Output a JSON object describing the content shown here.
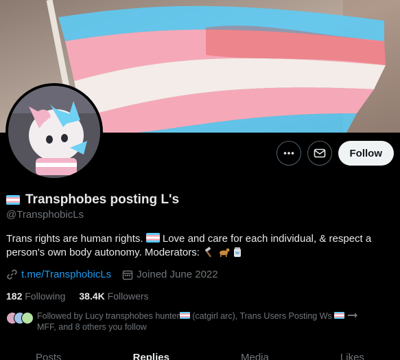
{
  "banner": {
    "flag_colors": [
      "#5bcefa",
      "#f5a9b8",
      "#ffffff",
      "#f5a9b8",
      "#5bcefa"
    ]
  },
  "avatar": {
    "name": "profile-avatar"
  },
  "actions": {
    "more_icon": "more-icon",
    "message_icon": "mail-icon",
    "follow_label": "Follow"
  },
  "profile": {
    "display_name": "Transphobes posting L's",
    "handle": "@TransphobicLs",
    "bio_text": "Trans rights are human rights.",
    "bio_text_2": "Love and care for each individual, & respect a person's own body autonomy. Moderators:",
    "website": "t.me/TransphobicLs",
    "joined": "Joined June 2022"
  },
  "stats": {
    "following_count": "182",
    "following_label": "Following",
    "followers_count": "38.4K",
    "followers_label": "Followers"
  },
  "followed_by": {
    "prefix": "Followed by Lucy transphobes hunter",
    "mid": "(catgirl arc), Trans Users Posting Ws",
    "suffix": "MFF, and 8 others you follow"
  },
  "tabs": [
    "Posts",
    "Replies",
    "Media",
    "Likes"
  ],
  "active_tab_index": 1,
  "colors": {
    "accent": "#1d9bf0",
    "muted": "#71767b",
    "text": "#e7e9ea",
    "background": "#000000"
  }
}
